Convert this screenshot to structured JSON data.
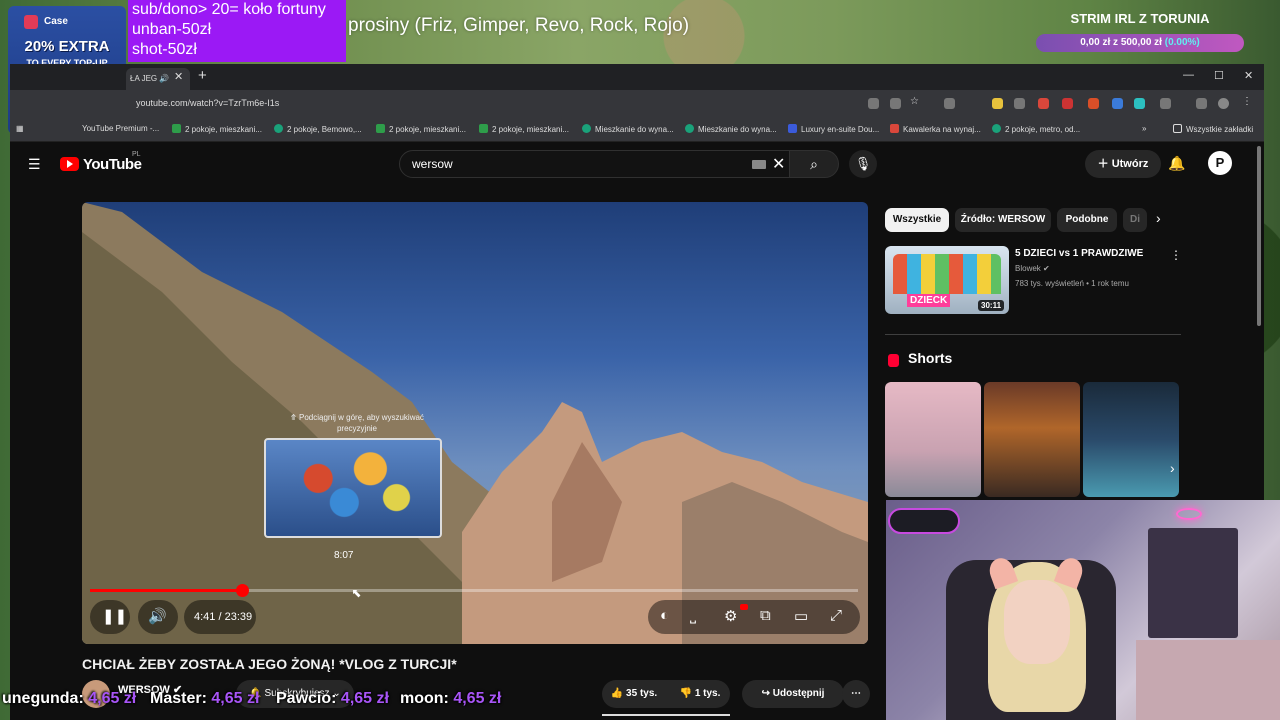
{
  "overlay": {
    "case_brand": "Case",
    "case_promo": "20% EXTRA",
    "case_promo_sub": "TO EVERY TOP-UP",
    "sub_lines": [
      "sub/dono> 20= koło fortuny",
      "unban-50zł",
      "shot-50zł"
    ],
    "ticker_top": "prosiny (Friz, Gimper, Revo, Rock, Rojo)",
    "goal_title": "STRIM IRL Z TORUNIA",
    "goal_current": "0,00 zł",
    "goal_sep": "z",
    "goal_target": "500,00 zł",
    "goal_percent": "(0.00%)",
    "goal_progress": 0.0
  },
  "browser": {
    "tab_title": "ŁA JEG",
    "url": "youtube.com/watch?v=TzrTm6e-I1s",
    "bookmarks": [
      "YouTube Premium -...",
      "2 pokoje, mieszkani...",
      "2 pokoje, Bemowo,...",
      "2 pokoje, mieszkani...",
      "2 pokoje, mieszkani...",
      "Mieszkanie do wyna...",
      "Mieszkanie do wyna...",
      "Luxury en-suite Dou...",
      "Kawalerka na wynaj...",
      "2 pokoje, metro, od..."
    ],
    "bookmarks_all": "Wszystkie zakładki",
    "profile_initial": "P"
  },
  "youtube": {
    "logo_text": "YouTube",
    "region": "PL",
    "search_value": "wersow",
    "create_label": "Utwórz",
    "profile_initial": "P",
    "player": {
      "scrub_hint": "⤊ Podciągnij w górę, aby wyszukiwać precyzyjnie",
      "preview_time": "8:07",
      "current_time": "4:41",
      "duration": "23:39",
      "time_display": "4:41 / 23:39",
      "progress": 0.198,
      "hover_position": 0.343
    },
    "video": {
      "title": "CHCIAŁ ŻEBY ZOSTAŁA JEGO ŻONĄ! *VLOG Z TURCJI*",
      "channel": "WERSOW",
      "subscribe_label": "Subskrybujesz",
      "likes": "35 tys.",
      "dislikes": "1 tys.",
      "share_label": "Udostępnij"
    },
    "chips": [
      "Wszystkie",
      "Źródło: WERSOW",
      "Podobne",
      "Di"
    ],
    "recommendation": {
      "title": "5 DZIECI vs 1 PRAWDZIWE",
      "channel": "Blowek",
      "meta": "783 tys. wyświetleń • 1 rok temu",
      "duration": "30:11",
      "thumb_text": "DZIECK"
    },
    "shorts_title": "Shorts"
  },
  "ticker_bottom": [
    {
      "name": "unegunda:",
      "amount": "4,65 zł"
    },
    {
      "name": "Master:",
      "amount": "4,65 zł"
    },
    {
      "name": "Pawcio:",
      "amount": "4,65 zł"
    },
    {
      "name": "moon:",
      "amount": "4,65 zł"
    }
  ],
  "colors": {
    "accent_red": "#ff0000",
    "donor_purple": "#a855f7",
    "sub_box_purple": "#9b19f5",
    "yt_background": "#0f0f0f"
  }
}
